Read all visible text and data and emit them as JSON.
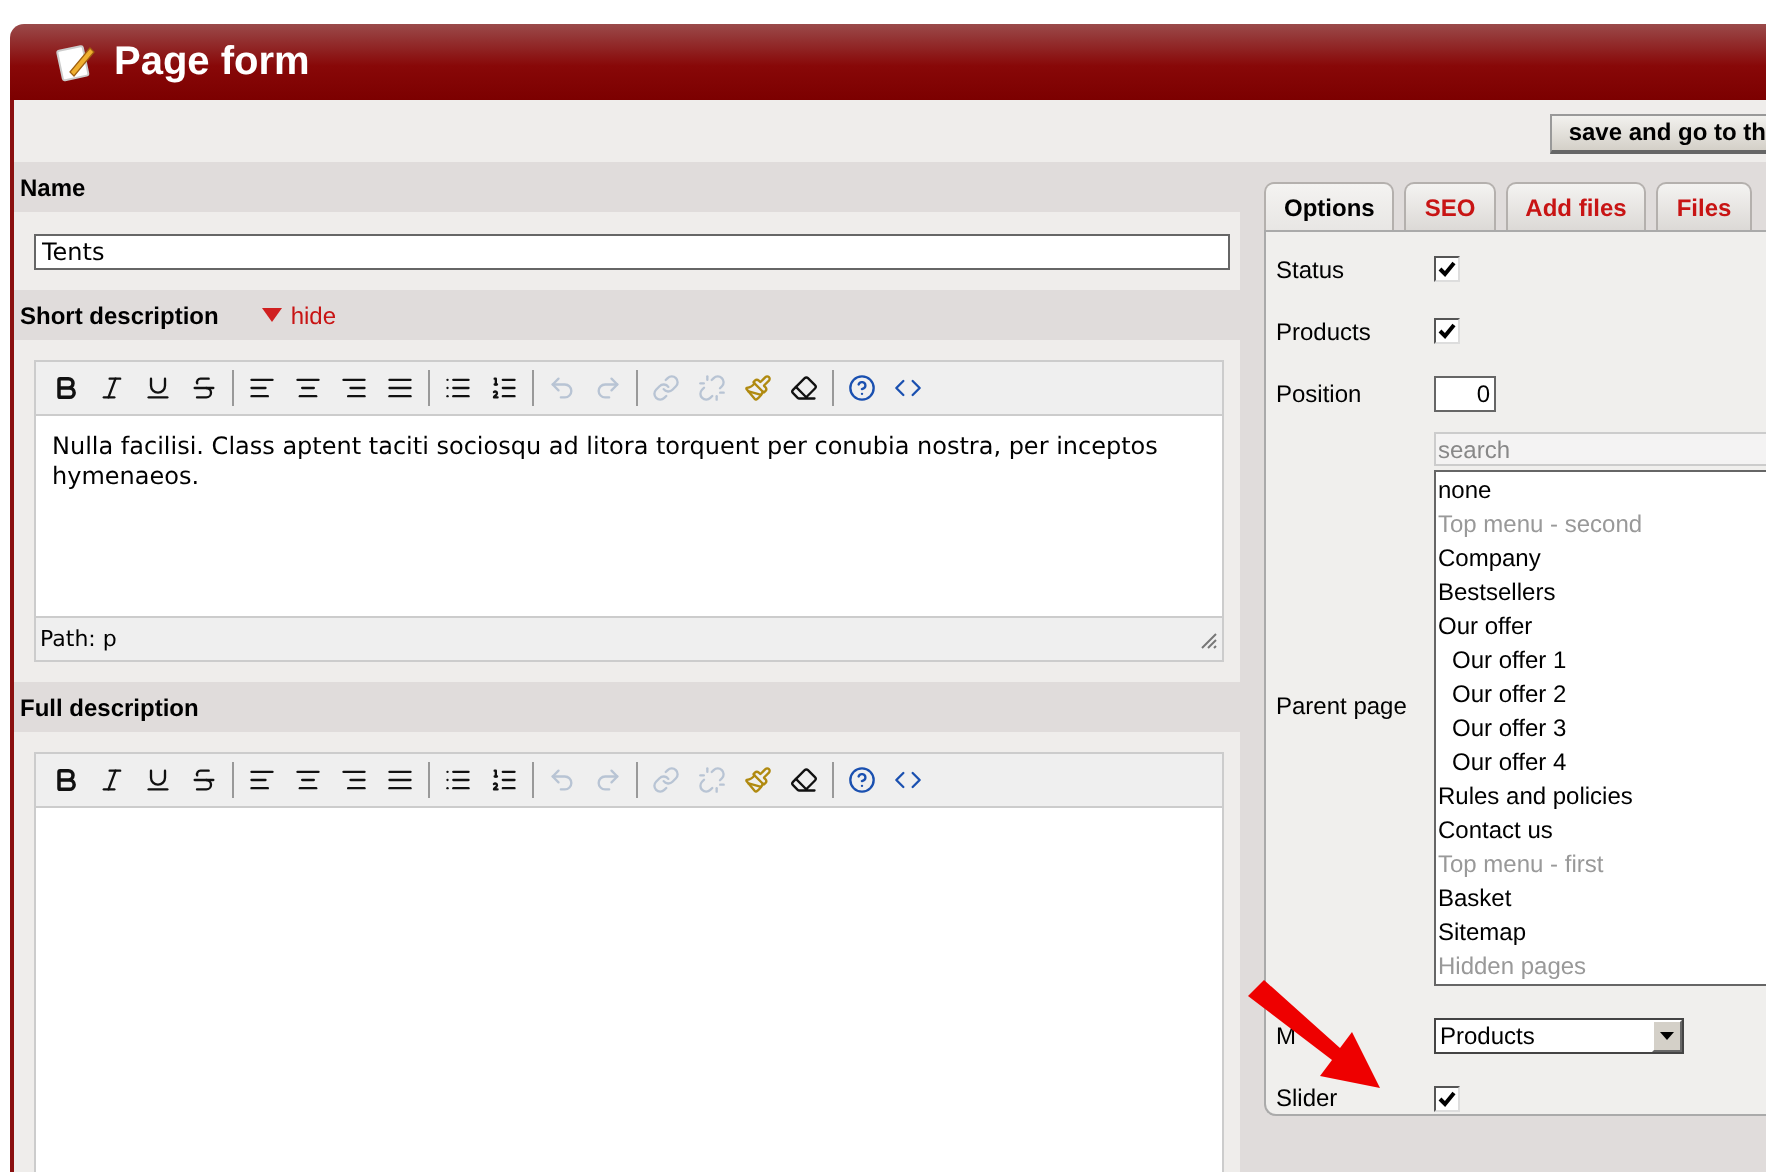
{
  "window": {
    "title": "Page form"
  },
  "toolbar": {
    "save_button": "save and go to th"
  },
  "name": {
    "label": "Name",
    "value": "Tents"
  },
  "short_description": {
    "label": "Short description",
    "toggle": "hide",
    "expanded": true,
    "text": "Nulla facilisi. Class aptent taciti sociosqu ad litora torquent per conubia nostra, per inceptos hymenaeos.",
    "path": "Path: p"
  },
  "full_description": {
    "label": "Full description"
  },
  "editor_toolbar": [
    {
      "kind": "bold",
      "disabled": false
    },
    {
      "kind": "italic",
      "disabled": false
    },
    {
      "kind": "underline",
      "disabled": false
    },
    {
      "kind": "strike",
      "disabled": false
    },
    {
      "kind": "separator"
    },
    {
      "kind": "align-left",
      "disabled": false
    },
    {
      "kind": "align-center",
      "disabled": false
    },
    {
      "kind": "align-right",
      "disabled": false
    },
    {
      "kind": "align-justify",
      "disabled": false
    },
    {
      "kind": "separator"
    },
    {
      "kind": "bullets",
      "disabled": false
    },
    {
      "kind": "numbers",
      "disabled": false
    },
    {
      "kind": "separator"
    },
    {
      "kind": "undo",
      "disabled": true
    },
    {
      "kind": "redo",
      "disabled": true
    },
    {
      "kind": "separator"
    },
    {
      "kind": "link",
      "disabled": true
    },
    {
      "kind": "unlink",
      "disabled": true
    },
    {
      "kind": "cleanup",
      "disabled": false
    },
    {
      "kind": "eraser",
      "disabled": false
    },
    {
      "kind": "separator"
    },
    {
      "kind": "help",
      "disabled": false
    },
    {
      "kind": "html",
      "disabled": false
    }
  ],
  "tabs": [
    {
      "label": "Options",
      "selected": true
    },
    {
      "label": "SEO",
      "selected": false
    },
    {
      "label": "Add files",
      "selected": false
    },
    {
      "label": "Files",
      "selected": false
    }
  ],
  "options": {
    "status": {
      "label": "Status",
      "checked": true
    },
    "products": {
      "label": "Products",
      "checked": true
    },
    "position": {
      "label": "Position",
      "value": "0"
    },
    "parent_page": {
      "label": "Parent page",
      "placeholder": "search",
      "items": [
        {
          "label": "none",
          "disabled": false
        },
        {
          "label": "Top menu - second",
          "disabled": true
        },
        {
          "label": "Company",
          "disabled": false
        },
        {
          "label": "Bestsellers",
          "disabled": false
        },
        {
          "label": "Our offer",
          "disabled": false,
          "children": [
            {
              "label": "Our offer 1",
              "disabled": false
            },
            {
              "label": "Our offer 2",
              "disabled": false
            },
            {
              "label": "Our offer 3",
              "disabled": false
            },
            {
              "label": "Our offer 4",
              "disabled": false
            }
          ]
        },
        {
          "label": "Rules and policies",
          "disabled": false
        },
        {
          "label": "Contact us",
          "disabled": false
        },
        {
          "label": "Top menu - first",
          "disabled": true
        },
        {
          "label": "Basket",
          "disabled": false
        },
        {
          "label": "Sitemap",
          "disabled": false
        },
        {
          "label": "Hidden pages",
          "disabled": true
        }
      ]
    },
    "menu": {
      "label": "M",
      "value": "Products"
    },
    "slider": {
      "label": "Slider",
      "checked": true
    }
  }
}
